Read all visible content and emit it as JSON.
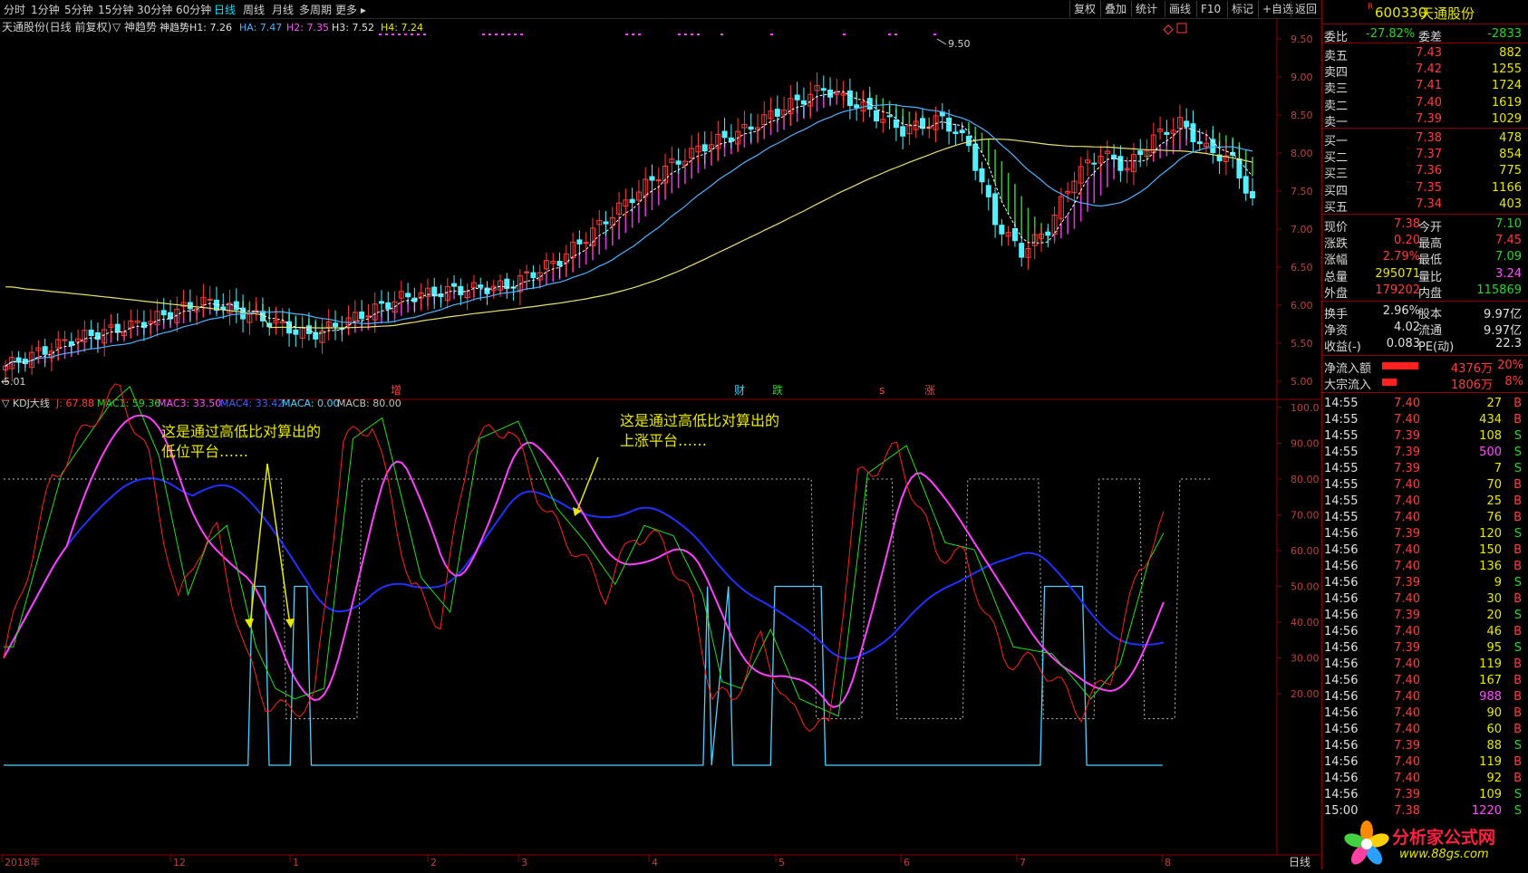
{
  "colors": {
    "up": "#ff3c3c",
    "down": "#2bd42b",
    "accent": "#00e5ff",
    "bg": "#000000",
    "grid": "#8b0000",
    "ma_white": "#ffffff",
    "ma_blue": "#4fb0ff",
    "ma_yellow": "#e8e070",
    "kdj_k": "#ff2020",
    "kdj_d": "#20e020",
    "mac3": "#ff40ff",
    "mac4": "#2030ff",
    "plat": "#4fd0ff"
  },
  "periods": [
    "分时",
    "1分钟",
    "5分钟",
    "15分钟",
    "30分钟",
    "60分钟",
    "日线",
    "周线",
    "月线",
    "多周期",
    "更多 ▸"
  ],
  "active_period": "日线",
  "toolbar": [
    "复权",
    "叠加",
    "统计",
    "画线",
    "F10",
    "标记",
    "+自选",
    "返回"
  ],
  "stock": {
    "code": "600330",
    "name": "天通股份",
    "marker": "R"
  },
  "main": {
    "title": "天通股份(日线 前复权)",
    "indicator": "▽ 神趋势",
    "params": [
      {
        "label": "神趋势H1: 7.26",
        "color": "#e0e0e0"
      },
      {
        "label": "HA: 7.47",
        "color": "#4fb0ff"
      },
      {
        "label": "H2: 7.35",
        "color": "#ff50ff"
      },
      {
        "label": "H3: 7.52",
        "color": "#e0e0e0"
      },
      {
        "label": "H4: 7.24",
        "color": "#e8e800"
      }
    ],
    "ylabels": [
      "9.50",
      "9.00",
      "8.50",
      "8.00",
      "7.50",
      "7.00",
      "6.50",
      "6.00",
      "5.50",
      "5.00"
    ],
    "max_label": "9.50",
    "min_label": "5.01",
    "events": [
      {
        "t": "增",
        "c": "#ff3c3c"
      },
      {
        "t": "财",
        "c": "#2bd4ff"
      },
      {
        "t": "跌",
        "c": "#2bd42b"
      },
      {
        "t": "s",
        "c": "#ff3c3c"
      },
      {
        "t": "涨",
        "c": "#ff3c3c"
      }
    ]
  },
  "kdj": {
    "title": "▽ KDJ大线",
    "params": [
      {
        "label": "J: 67.88",
        "color": "#ff3c3c"
      },
      {
        "label": "MAC1: 59.36",
        "color": "#2bd42b"
      },
      {
        "label": "MAC3: 33.50",
        "color": "#ff50ff"
      },
      {
        "label": "MAC4: 33.42",
        "color": "#4060ff"
      },
      {
        "label": "MACA: 0.00",
        "color": "#4fd0ff"
      },
      {
        "label": "MACB: 80.00",
        "color": "#c0c0c0"
      }
    ],
    "ylabels": [
      "100.0",
      "90.00",
      "80.00",
      "70.00",
      "60.00",
      "50.00",
      "40.00",
      "30.00",
      "20.00"
    ],
    "annotation1": [
      "这是通过高低比对算出的",
      "低位平台……"
    ],
    "annotation2": [
      "这是通过高低比对算出的",
      "上涨平台……"
    ]
  },
  "xaxis": {
    "labels": [
      "2018年",
      "12",
      "1",
      "2",
      "3",
      "4",
      "5",
      "6",
      "7",
      "8"
    ],
    "unit": "日线"
  },
  "quote": {
    "weibi": {
      "label": "委比",
      "value": "-27.82%",
      "label2": "委差",
      "value2": "-2833"
    },
    "sells": [
      {
        "label": "卖五",
        "price": "7.43",
        "vol": "882"
      },
      {
        "label": "卖四",
        "price": "7.42",
        "vol": "1255"
      },
      {
        "label": "卖三",
        "price": "7.41",
        "vol": "1724"
      },
      {
        "label": "卖二",
        "price": "7.40",
        "vol": "1619"
      },
      {
        "label": "卖一",
        "price": "7.39",
        "vol": "1029"
      }
    ],
    "buys": [
      {
        "label": "买一",
        "price": "7.38",
        "vol": "478"
      },
      {
        "label": "买二",
        "price": "7.37",
        "vol": "854"
      },
      {
        "label": "买三",
        "price": "7.36",
        "vol": "775"
      },
      {
        "label": "买四",
        "price": "7.35",
        "vol": "1166"
      },
      {
        "label": "买五",
        "price": "7.34",
        "vol": "403"
      }
    ],
    "stats": [
      {
        "l1": "现价",
        "v1": "7.38",
        "c1": "red",
        "l2": "今开",
        "v2": "7.10",
        "c2": "green"
      },
      {
        "l1": "涨跌",
        "v1": "0.20",
        "c1": "red",
        "l2": "最高",
        "v2": "7.45",
        "c2": "red"
      },
      {
        "l1": "涨幅",
        "v1": "2.79%",
        "c1": "red",
        "l2": "最低",
        "v2": "7.09",
        "c2": "green"
      },
      {
        "l1": "总量",
        "v1": "295071",
        "c1": "yellow",
        "l2": "量比",
        "v2": "3.24",
        "c2": "mag"
      },
      {
        "l1": "外盘",
        "v1": "179202",
        "c1": "red",
        "l2": "内盘",
        "v2": "115869",
        "c2": "green"
      }
    ],
    "stats2": [
      {
        "l1": "换手",
        "v1": "2.96%",
        "l2": "股本",
        "v2": "9.97亿"
      },
      {
        "l1": "净资",
        "v1": "4.02",
        "l2": "流通",
        "v2": "9.97亿"
      },
      {
        "l1": "收益(-)",
        "v1": "0.083",
        "l2": "PE(动)",
        "v2": "22.3"
      }
    ],
    "flows": [
      {
        "label": "净流入额",
        "value": "4376万",
        "pct": "20%",
        "bar": 0.2
      },
      {
        "label": "大宗流入",
        "value": "1806万",
        "pct": "8%",
        "bar": 0.08
      }
    ]
  },
  "ticks": [
    {
      "t": "14:55",
      "p": "7.40",
      "v": "27",
      "s": "B"
    },
    {
      "t": "14:55",
      "p": "7.40",
      "v": "434",
      "s": "B"
    },
    {
      "t": "14:55",
      "p": "7.39",
      "v": "108",
      "s": "S"
    },
    {
      "t": "14:55",
      "p": "7.39",
      "v": "500",
      "s": "S"
    },
    {
      "t": "14:55",
      "p": "7.39",
      "v": "7",
      "s": "S"
    },
    {
      "t": "14:55",
      "p": "7.40",
      "v": "70",
      "s": "B"
    },
    {
      "t": "14:55",
      "p": "7.40",
      "v": "25",
      "s": "B"
    },
    {
      "t": "14:55",
      "p": "7.40",
      "v": "76",
      "s": "B"
    },
    {
      "t": "14:56",
      "p": "7.39",
      "v": "120",
      "s": "S"
    },
    {
      "t": "14:56",
      "p": "7.40",
      "v": "150",
      "s": "B"
    },
    {
      "t": "14:56",
      "p": "7.40",
      "v": "136",
      "s": "B"
    },
    {
      "t": "14:56",
      "p": "7.39",
      "v": "9",
      "s": "S"
    },
    {
      "t": "14:56",
      "p": "7.40",
      "v": "30",
      "s": "B"
    },
    {
      "t": "14:56",
      "p": "7.39",
      "v": "20",
      "s": "S"
    },
    {
      "t": "14:56",
      "p": "7.40",
      "v": "46",
      "s": "B"
    },
    {
      "t": "14:56",
      "p": "7.39",
      "v": "95",
      "s": "S"
    },
    {
      "t": "14:56",
      "p": "7.40",
      "v": "119",
      "s": "B"
    },
    {
      "t": "14:56",
      "p": "7.40",
      "v": "167",
      "s": "B"
    },
    {
      "t": "14:56",
      "p": "7.40",
      "v": "988",
      "s": "B"
    },
    {
      "t": "14:56",
      "p": "7.40",
      "v": "90",
      "s": "B"
    },
    {
      "t": "14:56",
      "p": "7.40",
      "v": "60",
      "s": "B"
    },
    {
      "t": "14:56",
      "p": "7.39",
      "v": "88",
      "s": "S"
    },
    {
      "t": "14:56",
      "p": "7.40",
      "v": "119",
      "s": "B"
    },
    {
      "t": "14:56",
      "p": "7.40",
      "v": "92",
      "s": "B"
    },
    {
      "t": "14:56",
      "p": "7.39",
      "v": "109",
      "s": "S"
    },
    {
      "t": "15:00",
      "p": "7.38",
      "v": "1220",
      "s": "S"
    }
  ],
  "watermark": {
    "brand": "分析家公式网",
    "url": "www.88gs.com"
  }
}
